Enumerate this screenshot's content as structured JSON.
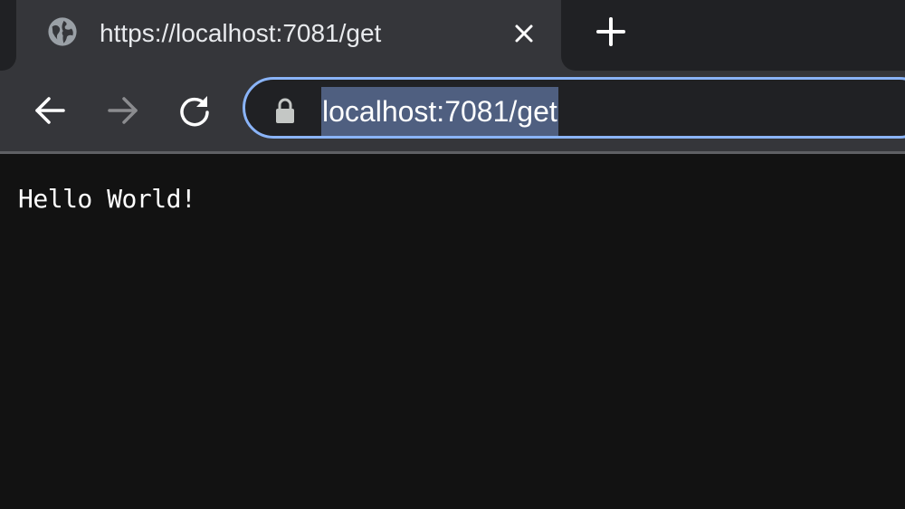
{
  "tab": {
    "title": "https://localhost:7081/get",
    "favicon": "globe-icon",
    "close_icon": "close-icon"
  },
  "tabstrip": {
    "new_tab_icon": "plus-icon"
  },
  "toolbar": {
    "back_icon": "arrow-left-icon",
    "forward_icon": "arrow-right-icon",
    "reload_icon": "reload-icon",
    "address": {
      "security_icon": "lock-icon",
      "url": "localhost:7081/get"
    }
  },
  "page": {
    "body_text": "Hello World!"
  },
  "colors": {
    "tabstrip_bg": "#202124",
    "toolbar_bg": "#35363a",
    "omnibox_focus_ring": "#8ab4f8",
    "url_selection": "#4f5f80",
    "content_bg": "#121212",
    "text": "#ffffff"
  }
}
